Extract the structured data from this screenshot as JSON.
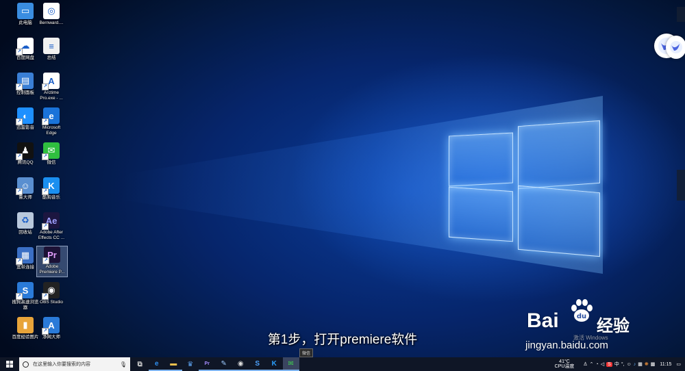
{
  "desktop": {
    "icons_col1": [
      {
        "label": "此电脑",
        "icon": "computer-icon",
        "color": "#3a8de0",
        "glyph": "▭"
      },
      {
        "label": "百度网盘",
        "icon": "baidu-netdisk-icon",
        "color": "#ffffff",
        "glyph": "☁"
      },
      {
        "label": "控制面板",
        "icon": "control-panel-icon",
        "color": "#3a7fd6",
        "glyph": "▤"
      },
      {
        "label": "迅雷影音",
        "icon": "xunlei-player-icon",
        "color": "#1e90ff",
        "glyph": "◐"
      },
      {
        "label": "腾讯QQ",
        "icon": "qq-penguin-icon",
        "color": "#111111",
        "glyph": "♟"
      },
      {
        "label": "鲁大师",
        "icon": "ludashi-icon",
        "color": "#5a8fd0",
        "glyph": "☺"
      },
      {
        "label": "回收站",
        "icon": "recycle-bin-icon",
        "color": "#b8c8dc",
        "glyph": "♻"
      },
      {
        "label": "宽带连接",
        "icon": "broadband-connection-icon",
        "color": "#3b6fc4",
        "glyph": "▦"
      },
      {
        "label": "搜狗高速浏览\n器",
        "icon": "sogou-browser-icon",
        "color": "#2a7ad8",
        "glyph": "S"
      },
      {
        "label": "百度经验图片",
        "icon": "image-folder-icon",
        "color": "#e8a43a",
        "glyph": "▮"
      }
    ],
    "icons_col2": [
      {
        "label": "Bernward....",
        "icon": "bernward-app-icon",
        "color": "#ffffff",
        "glyph": "◎"
      },
      {
        "label": "总结",
        "icon": "text-document-icon",
        "color": "#f0f0f0",
        "glyph": "≡"
      },
      {
        "label": "Arctime\nPro.exe - ...",
        "icon": "arctime-icon",
        "color": "#ffffff",
        "glyph": "A"
      },
      {
        "label": "Microsoft\nEdge",
        "icon": "edge-icon",
        "color": "#1a73d9",
        "glyph": "e"
      },
      {
        "label": "微信",
        "icon": "wechat-icon",
        "color": "#2fbf3f",
        "glyph": "✉"
      },
      {
        "label": "酷狗音乐",
        "icon": "kugou-music-icon",
        "color": "#1a8ff0",
        "glyph": "K"
      },
      {
        "label": "Adobe After\nEffects CC ...",
        "icon": "after-effects-icon",
        "color": "#1c1640",
        "glyph": "Ae"
      },
      {
        "label": "Adobe\nPremiere P...",
        "icon": "premiere-pro-icon",
        "color": "#1c1236",
        "glyph": "Pr"
      },
      {
        "label": "OBS Studio",
        "icon": "obs-studio-icon",
        "color": "#222222",
        "glyph": "◉"
      },
      {
        "label": "净网大师",
        "icon": "jingwang-icon",
        "color": "#2a7ad8",
        "glyph": "A"
      }
    ]
  },
  "caption": "第1步，打开premiere软件",
  "watermark": {
    "brand_left": "Bai",
    "brand_right": "经验",
    "url": "jingyan.baidu.com",
    "activate_text": "激活 Windows"
  },
  "taskbar": {
    "search_placeholder": "在这里输入你要搜索的内容",
    "tooltip": "微信",
    "temperature": "41°C",
    "cpu_label": "CPU温度",
    "time": "11:15",
    "ime": "中",
    "apps": [
      {
        "icon": "task-view-icon",
        "glyph": "⧉",
        "color": "#cccccc"
      },
      {
        "icon": "edge-taskbar-icon",
        "glyph": "e",
        "color": "#2f8ff0"
      },
      {
        "icon": "file-explorer-icon",
        "glyph": "▬",
        "color": "#f2c14e"
      },
      {
        "icon": "app-taskbar-icon",
        "glyph": "♛",
        "color": "#5da3f0"
      },
      {
        "icon": "premiere-taskbar-icon",
        "glyph": "Pr",
        "color": "#a58cff"
      },
      {
        "icon": "arctime-taskbar-icon",
        "glyph": "✎",
        "color": "#9ecbff"
      },
      {
        "icon": "obs-taskbar-icon",
        "glyph": "◉",
        "color": "#dddddd"
      },
      {
        "icon": "sogou-taskbar-icon",
        "glyph": "S",
        "color": "#4ea3ff"
      },
      {
        "icon": "kugou-taskbar-icon",
        "glyph": "K",
        "color": "#2aa0ff"
      },
      {
        "icon": "wechat-taskbar-icon",
        "glyph": "✉",
        "color": "#3fcf4f"
      }
    ]
  }
}
